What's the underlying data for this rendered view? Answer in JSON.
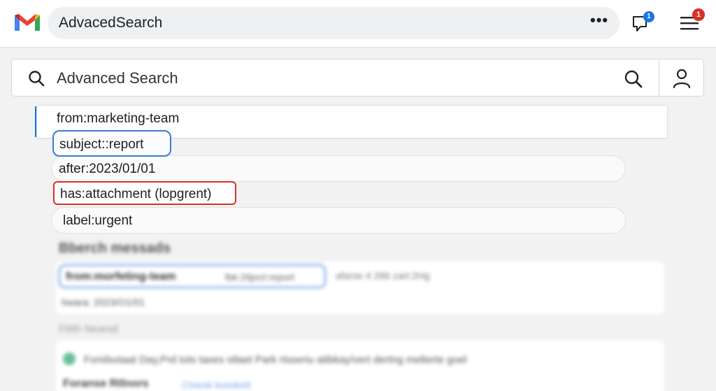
{
  "header": {
    "title": "AdvacedSearch",
    "more_label": "•••",
    "chat_badge": "1",
    "menu_badge": "1"
  },
  "search": {
    "label": "Advanced Search"
  },
  "suggestions": [
    "from:marketing-team",
    "subject::report",
    "after:2023/01/01",
    "has:attachment (lopgrent)",
    "label:urgent"
  ],
  "results": {
    "section_title": "Bberch messads",
    "query_main": "from:morfeting-team",
    "query_rest": "lbk:2tijoct:report",
    "query_extra": "afarse 4 2tt6 zart:2Hg",
    "query_line2": "hwara: 2023/O1/01",
    "subhead": "Fitith Nearsd",
    "message_preview": "Foridsotaat Day,Prd tots taxes stlaet Park rtsseriu atibkay/vert dertng melterte goel",
    "message_sender": "Foranse Rtlnors",
    "message_link": "Ctnesk kusskett"
  },
  "colors": {
    "accent_blue": "#1a73e8",
    "alert_red": "#d93025",
    "gmail_red": "#ea4335"
  }
}
